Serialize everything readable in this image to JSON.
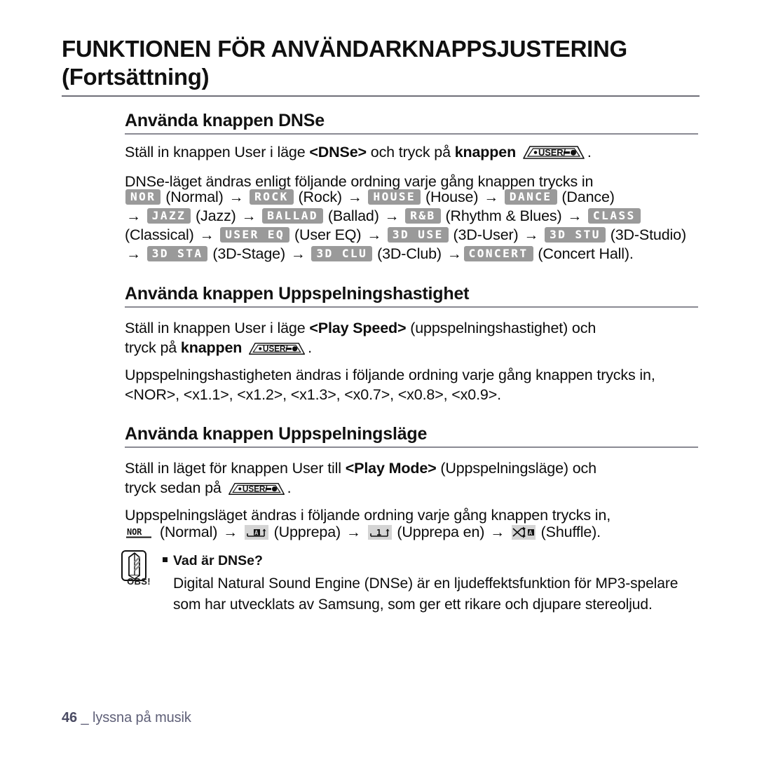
{
  "document": {
    "chapter_title_line1": "FUNKTIONEN FÖR ANVÄNDARKNAPPSJUSTERING",
    "chapter_title_line2": "(Fortsättning)"
  },
  "sections": {
    "dnse": {
      "heading": "Använda knappen DNSe",
      "intro_pre": "Ställ in knappen User i läge ",
      "intro_bold1": "<DNSe>",
      "intro_mid": " och tryck på ",
      "intro_bold2": "knappen",
      "intro_post": ".",
      "order_text": "DNSe-läget ändras enligt följande ordning varje gång knappen trycks in",
      "modes": [
        {
          "badge": "NOR",
          "label": "(Normal)"
        },
        {
          "badge": "ROCK",
          "label": "(Rock)"
        },
        {
          "badge": "HOUSE",
          "label": "(House)"
        },
        {
          "badge": "DANCE",
          "label": "(Dance)"
        },
        {
          "badge": "JAZZ",
          "label": "(Jazz)"
        },
        {
          "badge": "BALLAD",
          "label": "(Ballad)"
        },
        {
          "badge": "R&B",
          "label": "(Rhythm & Blues)"
        },
        {
          "badge": "CLASS",
          "label": "(Classical)"
        },
        {
          "badge": "USER EQ",
          "label": "(User EQ)"
        },
        {
          "badge": "3D USE",
          "label": "(3D-User)"
        },
        {
          "badge": "3D STU",
          "label": "(3D-Studio)"
        },
        {
          "badge": "3D STA",
          "label": "(3D-Stage)"
        },
        {
          "badge": "3D CLU",
          "label": "(3D-Club)"
        },
        {
          "badge": "CONCERT",
          "label": "(Concert Hall)."
        }
      ]
    },
    "play_speed": {
      "heading": "Använda knappen Uppspelningshastighet",
      "intro_pre": "Ställ in knappen User i läge ",
      "intro_bold1": "<Play Speed>",
      "intro_mid": " (uppspelningshastighet) och",
      "intro_line2_pre": "tryck på ",
      "intro_bold2": "knappen",
      "intro_post": ".",
      "order_text": "Uppspelningshastigheten ändras i följande ordning varje gång knappen trycks in,",
      "speeds_text": "<NOR>, <x1.1>, <x1.2>, <x1.3>, <x0.7>, <x0.8>, <x0.9>."
    },
    "play_mode": {
      "heading": "Använda knappen Uppspelningsläge",
      "intro_pre": "Ställ in läget för knappen User till ",
      "intro_bold1": "<Play Mode>",
      "intro_mid": " (Uppspelningsläge) och",
      "intro_line2_pre": "tryck sedan på ",
      "intro_post": ".",
      "order_text": "Uppspelningsläget ändras i följande ordning varje gång knappen trycks in,",
      "modes": [
        {
          "icon": "normal-mode-icon",
          "label": "(Normal)"
        },
        {
          "icon": "repeat-all-icon",
          "label": "(Upprepa)"
        },
        {
          "icon": "repeat-one-icon",
          "label": "(Upprepa en)"
        },
        {
          "icon": "shuffle-icon",
          "label": "(Shuffle)."
        }
      ]
    }
  },
  "note": {
    "obs_label": "OBS!",
    "title": "Vad är DNSe?",
    "body": "Digital Natural Sound Engine (DNSe) är en ljudeffektsfunktion för MP3-spelare som har utvecklats av Samsung, som ger ett rikare och djupare stereoljud."
  },
  "footer": {
    "page_number": "46",
    "separator": "_",
    "chapter": "lyssna på musik"
  },
  "colors": {
    "badge_bg": "#9a9a9a",
    "badge_text": "#ffffff",
    "footer_text": "#5e5f77",
    "rule": "#8a8a93"
  }
}
